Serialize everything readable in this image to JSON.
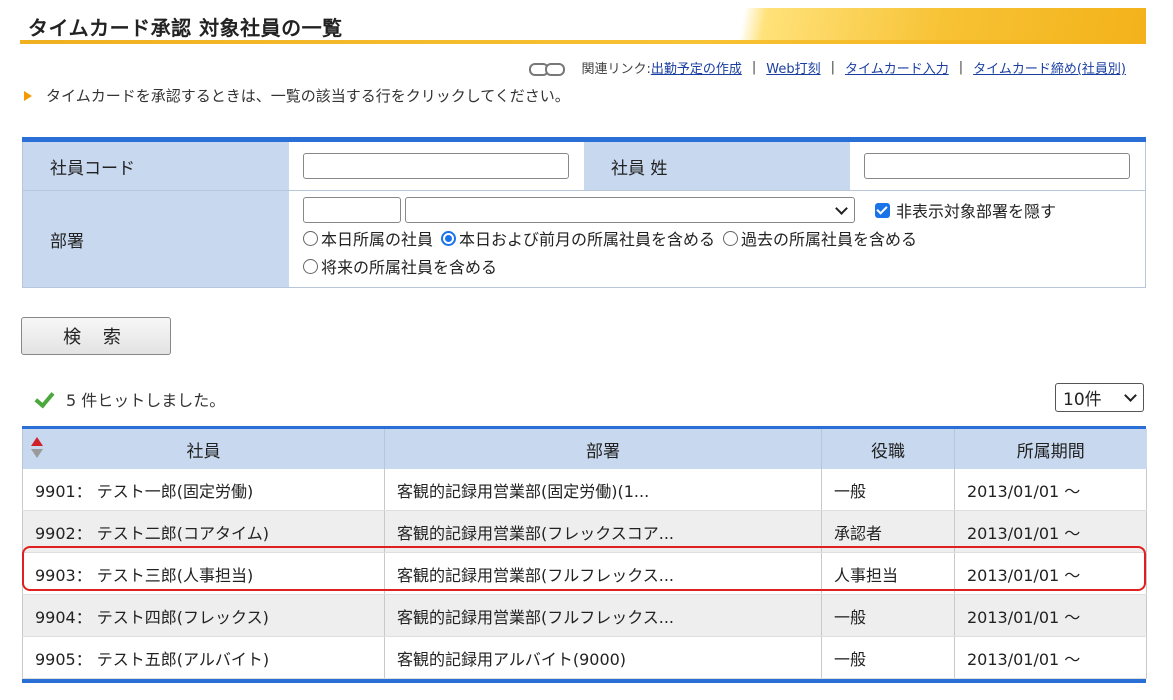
{
  "header": {
    "title": "タイムカード承認 対象社員の一覧"
  },
  "related_links": {
    "label": "関連リンク:",
    "items": [
      "出勤予定の作成",
      "Web打刻",
      "タイムカード入力",
      "タイムカード締め(社員別)"
    ],
    "separator": "|"
  },
  "instruction": "タイムカードを承認するときは、一覧の該当する行をクリックしてください。",
  "search_form": {
    "employee_code_label": "社員コード",
    "employee_code_value": "",
    "last_name_label": "社員 姓",
    "last_name_value": "",
    "department_label": "部署",
    "department_code_value": "",
    "department_selected": "",
    "hide_checkbox_label": "非表示対象部署を隠す",
    "hide_checkbox_checked": true,
    "radio_options": [
      {
        "label": "本日所属の社員",
        "selected": false
      },
      {
        "label": "本日および前月の所属社員を含める",
        "selected": true
      },
      {
        "label": "過去の所属社員を含める",
        "selected": false
      },
      {
        "label": "将来の所属社員を含める",
        "selected": false
      }
    ]
  },
  "search_button": "検 索",
  "result_message": "5 件ヒットしました。",
  "per_page": "10件",
  "table": {
    "columns": [
      "社員",
      "部署",
      "役職",
      "所属期間"
    ],
    "rows": [
      [
        "9901： テスト一郎(固定労働)",
        "客観的記録用営業部(固定労働)(1...",
        "一般",
        "2013/01/01 ～"
      ],
      [
        "9902： テスト二郎(コアタイム)",
        "客観的記録用営業部(フレックスコア...",
        "承認者",
        "2013/01/01 ～"
      ],
      [
        "9903： テスト三郎(人事担当)",
        "客観的記録用営業部(フルフレックス...",
        "人事担当",
        "2013/01/01 ～"
      ],
      [
        "9904： テスト四郎(フレックス)",
        "客観的記録用営業部(フルフレックス...",
        "一般",
        "2013/01/01 ～"
      ],
      [
        "9905： テスト五郎(アルバイト)",
        "客観的記録用アルバイト(9000)",
        "一般",
        "2013/01/01 ～"
      ]
    ],
    "highlighted_row": 2
  },
  "colors": {
    "accent_blue": "#2a6fd6",
    "label_bg": "#c7d8ef",
    "header_orange": "#f3b21a",
    "highlight_red": "#e02020"
  }
}
